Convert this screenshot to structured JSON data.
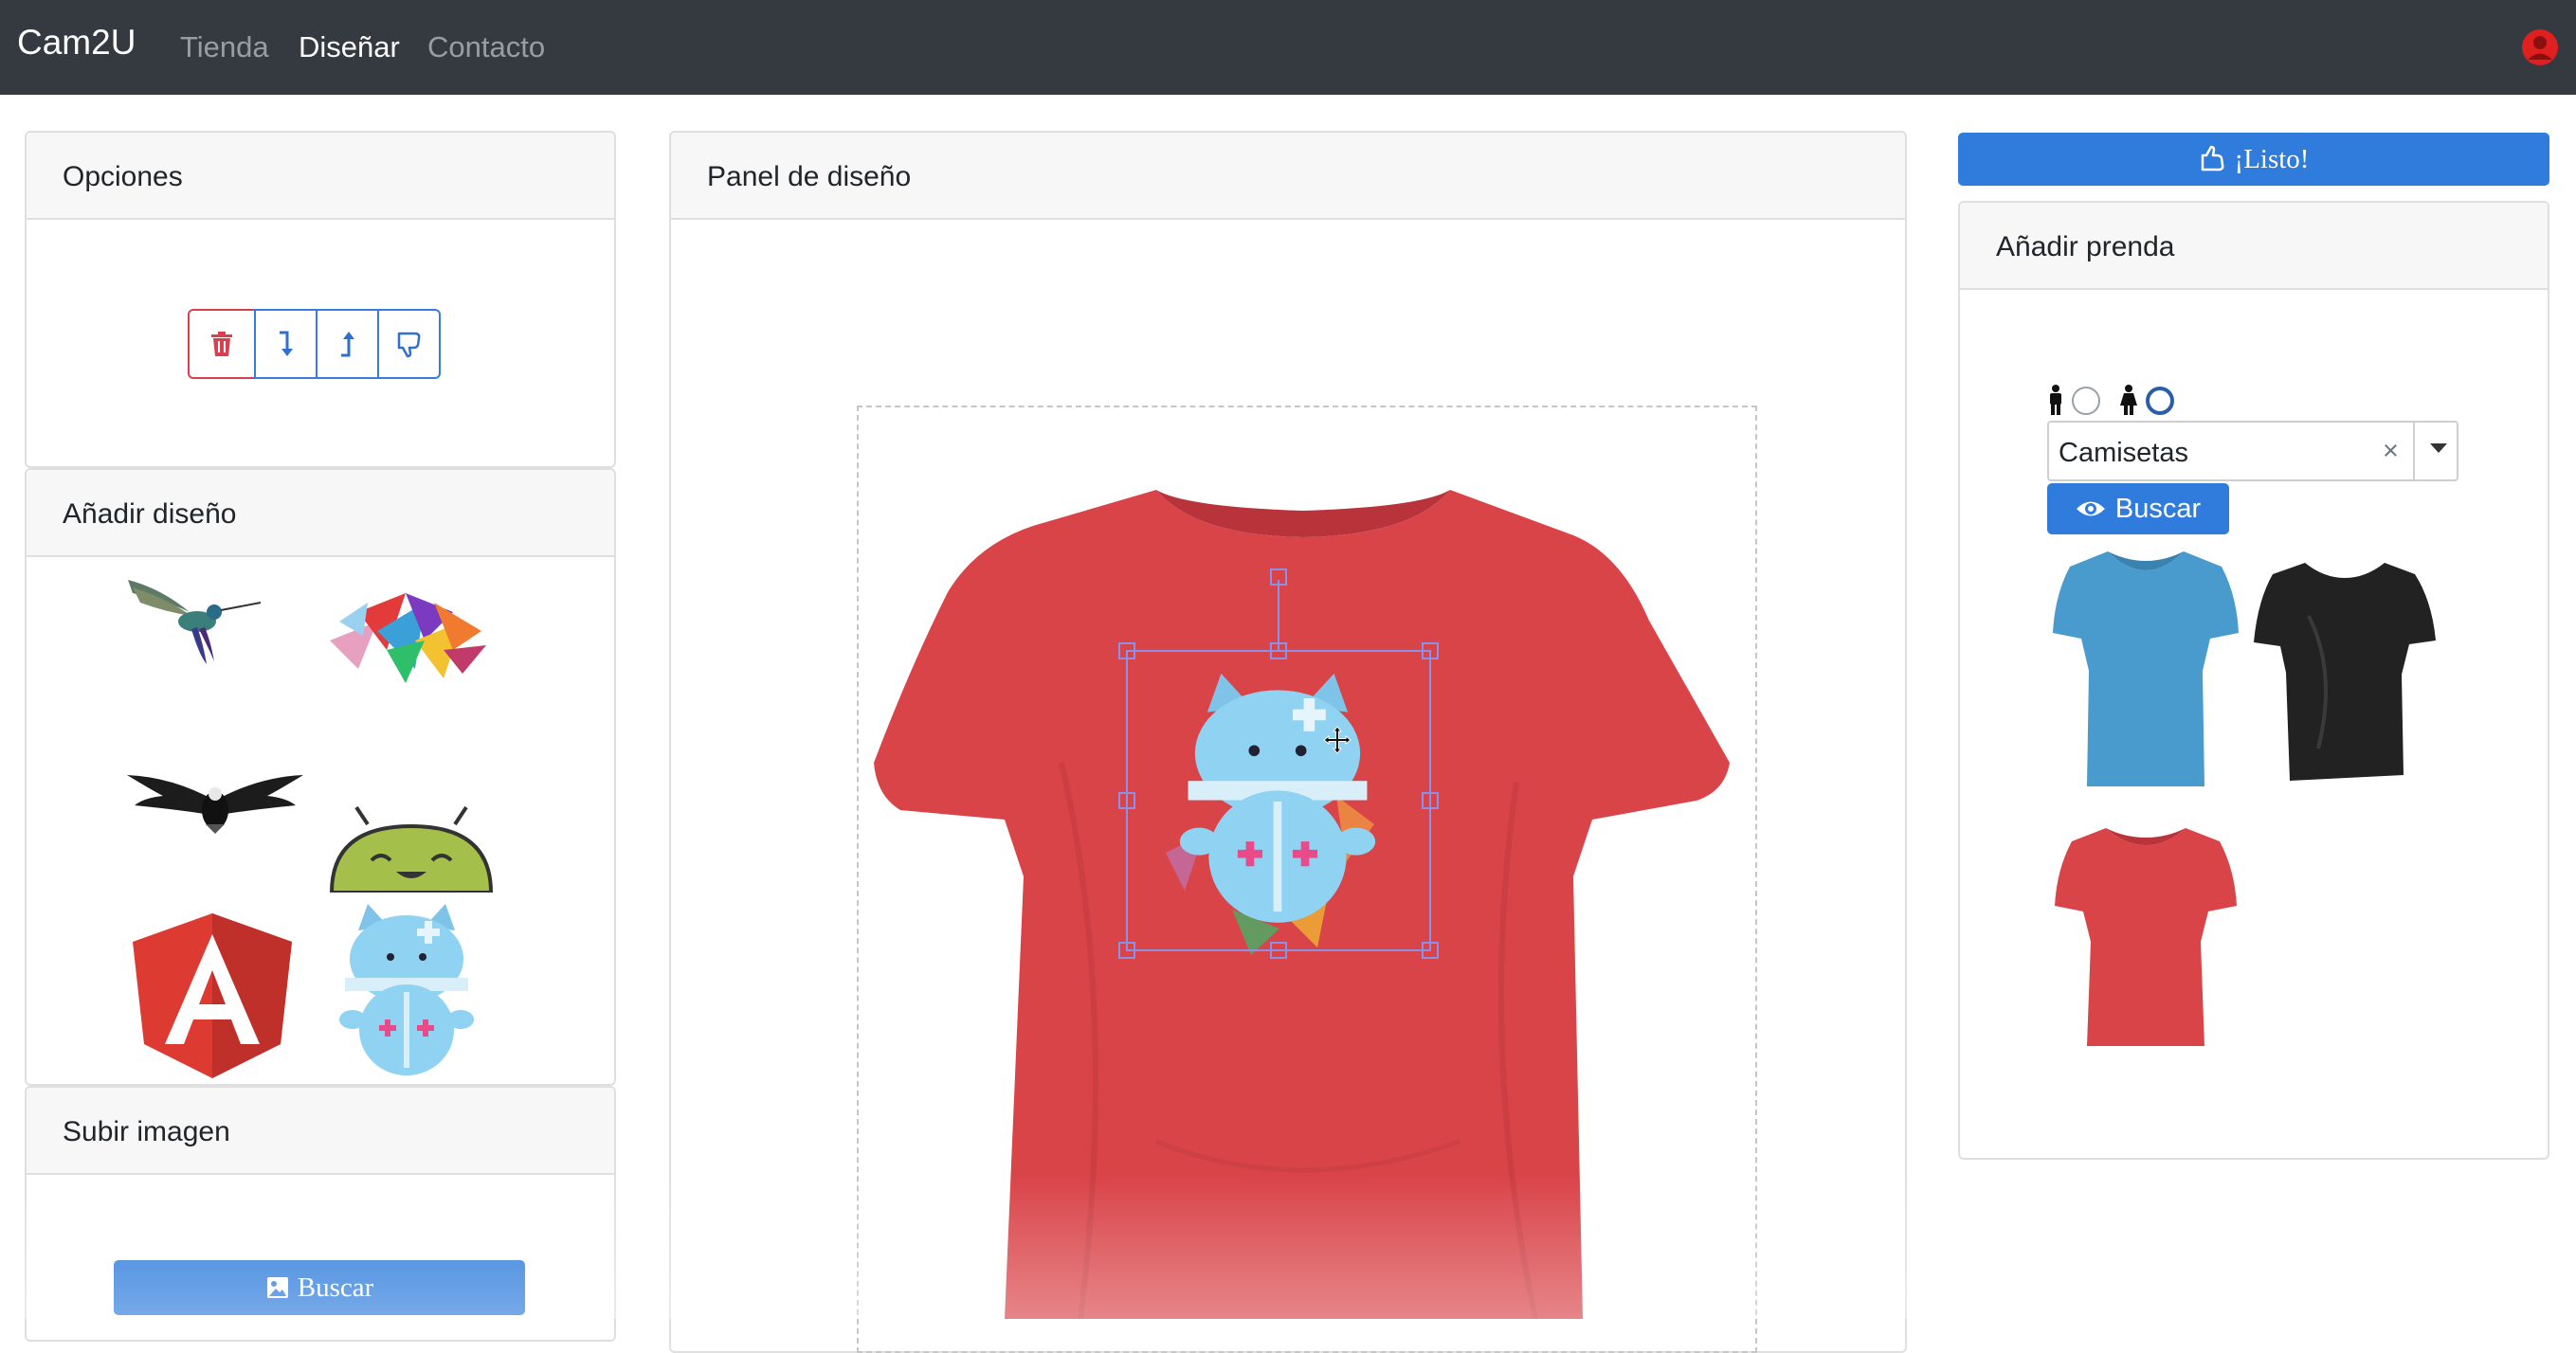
{
  "navbar": {
    "brand": "Cam2U",
    "links": [
      "Tienda",
      "Diseñar",
      "Contacto"
    ],
    "active": "Diseñar"
  },
  "options_card": {
    "title": "Opciones",
    "buttons": [
      "trash-icon",
      "send-backward-icon",
      "bring-forward-icon",
      "thumbs-down-icon"
    ]
  },
  "design_card": {
    "title": "Añadir diseño",
    "designs": [
      "hummingbird-icon",
      "triangles-icon",
      "eagle-icon",
      "android-icon",
      "angular-icon",
      "zipper-cat-icon"
    ]
  },
  "upload_card": {
    "title": "Subir imagen",
    "button_label": "Buscar"
  },
  "panel": {
    "title": "Panel de diseño",
    "shirt_color": "#d94449",
    "design_color": "#8fd2f1"
  },
  "ready_button": {
    "label": "¡Listo!"
  },
  "garment_card": {
    "title": "Añadir prenda",
    "gender_selected": "female",
    "category": "Camisetas",
    "search_label": "Buscar",
    "garments": [
      {
        "name": "blue-tshirt",
        "color": "#4a9bcd"
      },
      {
        "name": "black-tshirt",
        "color": "#222222"
      },
      {
        "name": "red-tshirt",
        "color": "#d94449"
      }
    ]
  },
  "colors": {
    "navbar": "#343a40",
    "primary": "#2f7cdc",
    "danger": "#d6404f"
  }
}
